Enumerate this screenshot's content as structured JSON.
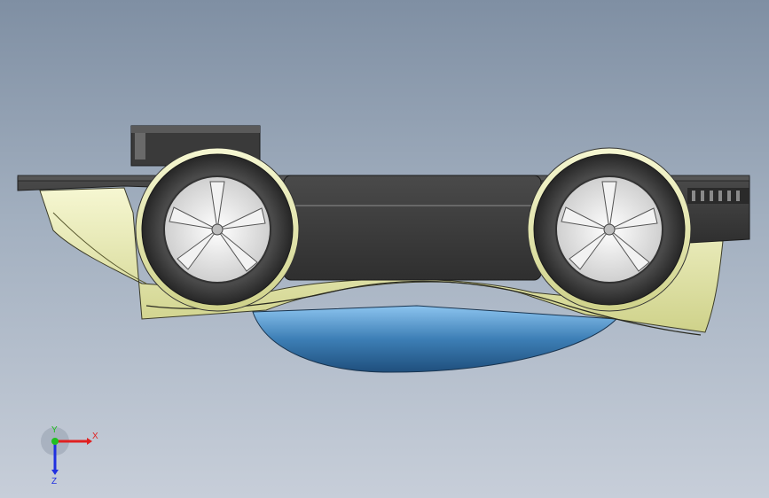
{
  "viewport": {
    "background_top": "#7f8fa3",
    "background_bottom": "#c7ced9"
  },
  "model": {
    "body_color": "#e9ebb0",
    "underside_color": "#3d7fb6",
    "chassis_color": "#3b3b3b",
    "wheel_tire_color": "#3a3a3a",
    "wheel_rim_color": "#e6e6e6"
  },
  "triad": {
    "x_label": "X",
    "y_label": "Y",
    "z_label": "Z",
    "x_color": "#e02020",
    "y_color": "#20c020",
    "z_color": "#2030e0"
  }
}
